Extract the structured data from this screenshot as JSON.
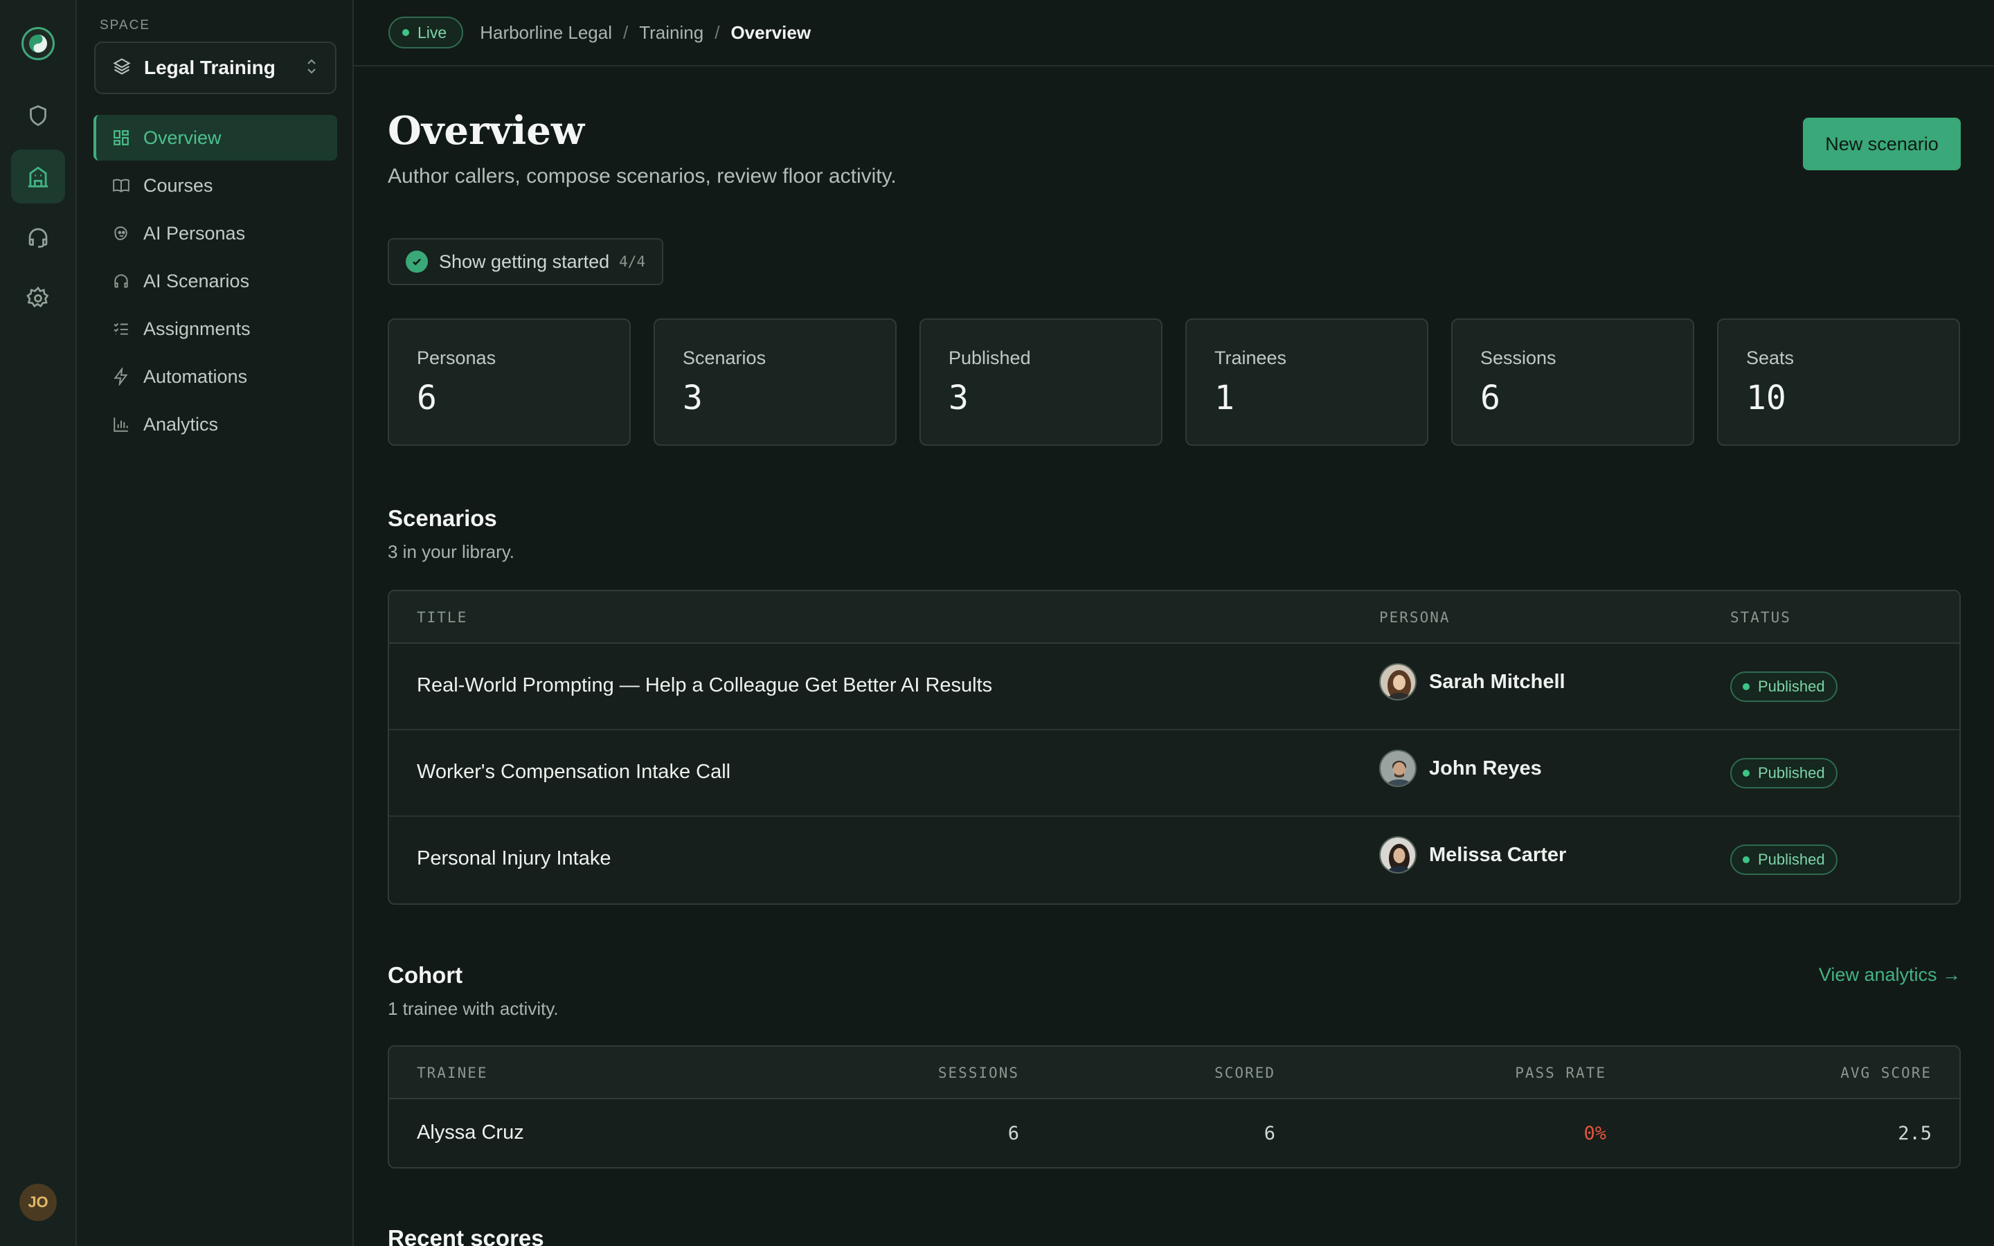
{
  "topbar": {
    "live_label": "Live",
    "breadcrumbs": [
      "Harborline Legal",
      "Training",
      "Overview"
    ]
  },
  "sidebar": {
    "space_label": "SPACE",
    "space_name": "Legal Training",
    "items": [
      {
        "label": "Overview",
        "icon": "grid-icon",
        "active": true
      },
      {
        "label": "Courses",
        "icon": "book-icon"
      },
      {
        "label": "AI Personas",
        "icon": "persona-icon"
      },
      {
        "label": "AI Scenarios",
        "icon": "headphones-icon"
      },
      {
        "label": "Assignments",
        "icon": "checklist-icon"
      },
      {
        "label": "Automations",
        "icon": "lightning-icon"
      },
      {
        "label": "Analytics",
        "icon": "bar-chart-icon"
      }
    ]
  },
  "rail": {
    "icons": [
      "logo-icon",
      "shield-icon",
      "building-icon",
      "headset-icon",
      "gear-icon"
    ],
    "avatar_initials": "JO"
  },
  "main": {
    "title": "Overview",
    "subtitle": "Author callers, compose scenarios, review floor activity.",
    "new_button": "New scenario",
    "getting_started": {
      "label": "Show getting started",
      "count": "4/4"
    },
    "stats": [
      {
        "label": "Personas",
        "value": "6"
      },
      {
        "label": "Scenarios",
        "value": "3"
      },
      {
        "label": "Published",
        "value": "3"
      },
      {
        "label": "Trainees",
        "value": "1"
      },
      {
        "label": "Sessions",
        "value": "6"
      },
      {
        "label": "Seats",
        "value": "10"
      }
    ]
  },
  "scenarios": {
    "title": "Scenarios",
    "subtitle": "3 in your library.",
    "columns": [
      "TITLE",
      "PERSONA",
      "STATUS"
    ],
    "rows": [
      {
        "title": "Real-World Prompting — Help a Colleague Get Better AI Results",
        "persona": "Sarah Mitchell",
        "status": "Published"
      },
      {
        "title": "Worker's Compensation Intake Call",
        "persona": "John Reyes",
        "status": "Published"
      },
      {
        "title": "Personal Injury Intake",
        "persona": "Melissa Carter",
        "status": "Published"
      }
    ]
  },
  "cohort": {
    "title": "Cohort",
    "subtitle": "1 trainee with activity.",
    "link": "View analytics →",
    "columns": [
      "TRAINEE",
      "SESSIONS",
      "SCORED",
      "PASS RATE",
      "AVG SCORE"
    ],
    "rows": [
      {
        "trainee": "Alyssa Cruz",
        "sessions": "6",
        "scored": "6",
        "pass_rate": "0%",
        "avg_score": "2.5"
      }
    ]
  },
  "recent": {
    "title": "Recent scores"
  },
  "colors": {
    "accent": "#3aa878",
    "danger": "#e5533f",
    "background": "#121a17"
  }
}
